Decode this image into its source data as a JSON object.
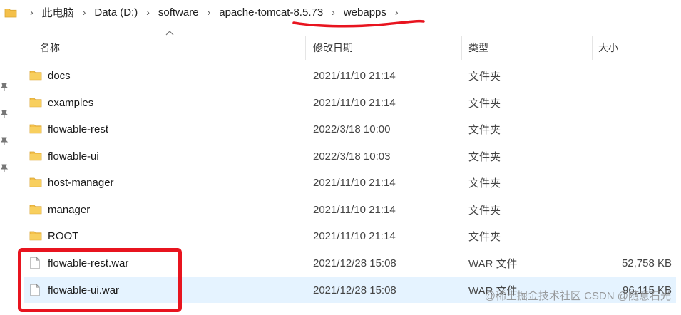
{
  "breadcrumb": {
    "items": [
      "此电脑",
      "Data (D:)",
      "software",
      "apache-tomcat-8.5.73",
      "webapps"
    ],
    "separator": "›"
  },
  "columns": {
    "name": "名称",
    "date": "修改日期",
    "type": "类型",
    "size": "大小"
  },
  "rows": [
    {
      "name": "docs",
      "date": "2021/11/10 21:14",
      "type": "文件夹",
      "size": "",
      "kind": "folder"
    },
    {
      "name": "examples",
      "date": "2021/11/10 21:14",
      "type": "文件夹",
      "size": "",
      "kind": "folder"
    },
    {
      "name": "flowable-rest",
      "date": "2022/3/18 10:00",
      "type": "文件夹",
      "size": "",
      "kind": "folder"
    },
    {
      "name": "flowable-ui",
      "date": "2022/3/18 10:03",
      "type": "文件夹",
      "size": "",
      "kind": "folder"
    },
    {
      "name": "host-manager",
      "date": "2021/11/10 21:14",
      "type": "文件夹",
      "size": "",
      "kind": "folder"
    },
    {
      "name": "manager",
      "date": "2021/11/10 21:14",
      "type": "文件夹",
      "size": "",
      "kind": "folder"
    },
    {
      "name": "ROOT",
      "date": "2021/11/10 21:14",
      "type": "文件夹",
      "size": "",
      "kind": "folder"
    },
    {
      "name": "flowable-rest.war",
      "date": "2021/12/28 15:08",
      "type": "WAR 文件",
      "size": "52,758 KB",
      "kind": "file"
    },
    {
      "name": "flowable-ui.war",
      "date": "2021/12/28 15:08",
      "type": "WAR 文件",
      "size": "96,115 KB",
      "kind": "file",
      "selected": true
    }
  ],
  "watermark": "@稀土掘金技术社区  CSDN @随意石光",
  "colors": {
    "annotation_red": "#e8141f",
    "folder_yellow": "#f4c04a",
    "selection": "#e5f3ff"
  }
}
